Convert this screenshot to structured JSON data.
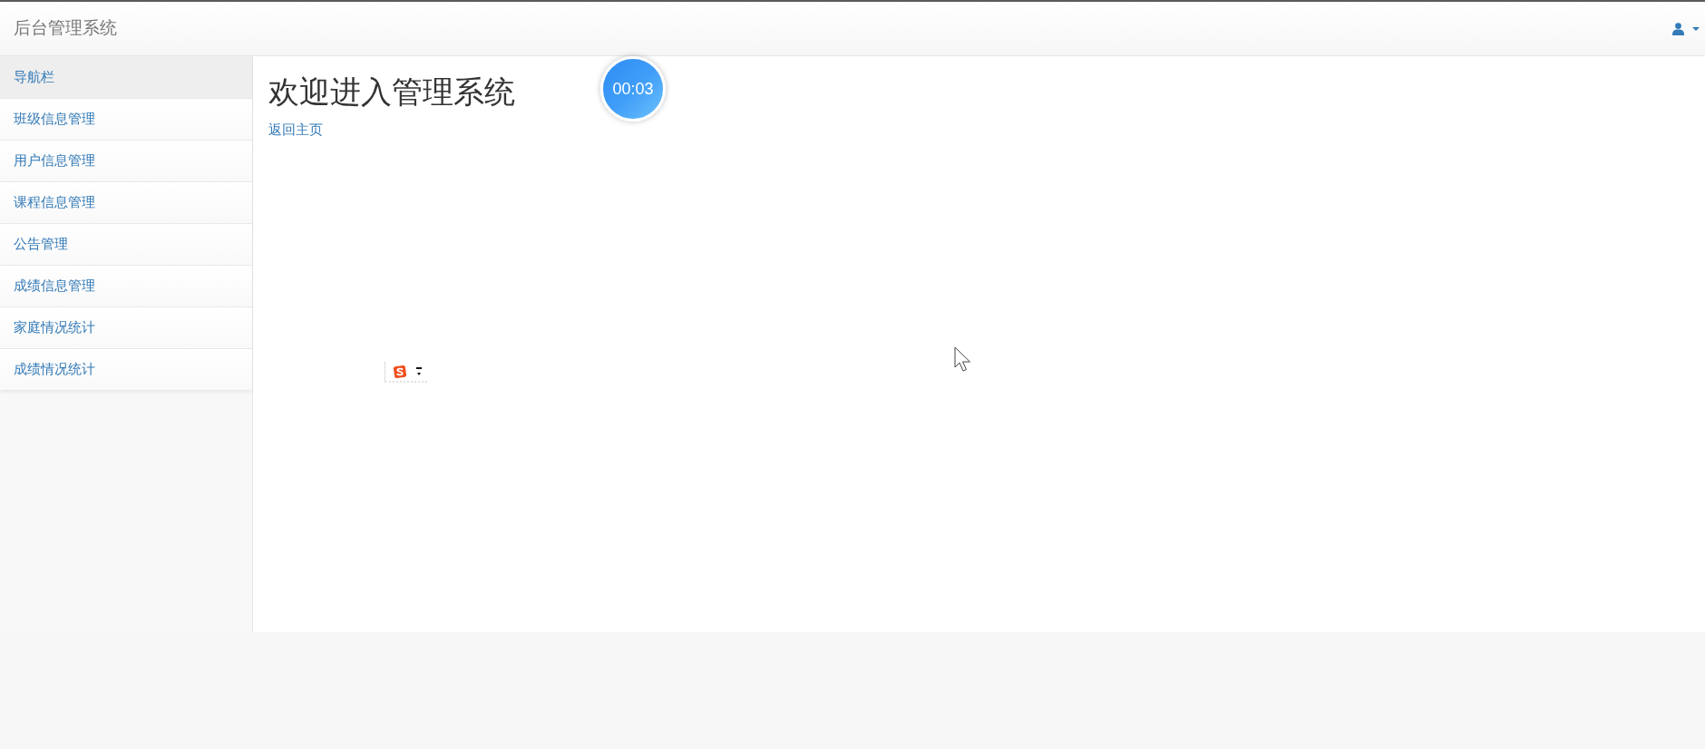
{
  "navbar": {
    "brand": "后台管理系统"
  },
  "sidebar": {
    "heading": "导航栏",
    "items": [
      "班级信息管理",
      "用户信息管理",
      "课程信息管理",
      "公告管理",
      "成绩信息管理",
      "家庭情况统计",
      "成绩情况统计"
    ]
  },
  "main": {
    "title": "欢迎进入管理系统",
    "link": "返回主页"
  },
  "timer": {
    "reading": "00:03"
  }
}
